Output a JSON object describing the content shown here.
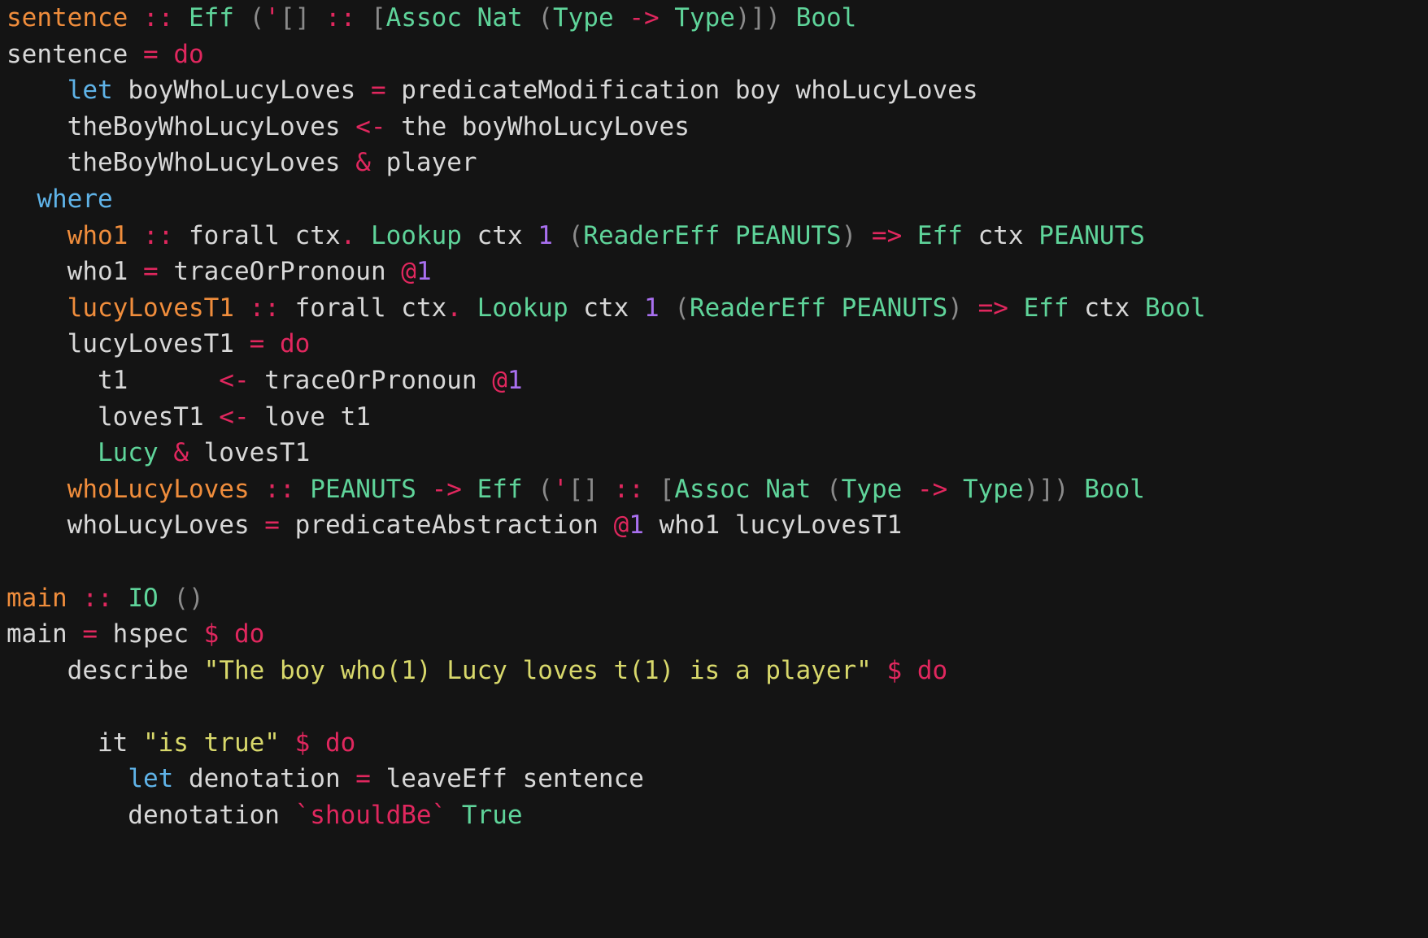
{
  "editor": {
    "language": "haskell",
    "background": "#141414",
    "font_size_px": 31,
    "line_height_px": 44.6
  },
  "colors": {
    "plain": "#d8d8d8",
    "function_name": "#f08d3c",
    "keyword": "#e0275e",
    "keyword_blue": "#5fb3e8",
    "type": "#5fd49a",
    "number": "#a970f0",
    "punctuation": "#8a8a8a",
    "string": "#d8d86b",
    "operator": "#e0275e"
  },
  "code": {
    "lines": [
      {
        "id": "line-1",
        "tokens": [
          {
            "text": "sentence",
            "style": "t-func"
          },
          {
            "text": " ",
            "style": "t-plain"
          },
          {
            "text": "::",
            "style": "t-kw"
          },
          {
            "text": " ",
            "style": "t-plain"
          },
          {
            "text": "Eff",
            "style": "t-type"
          },
          {
            "text": " ",
            "style": "t-plain"
          },
          {
            "text": "(",
            "style": "t-punct"
          },
          {
            "text": "'",
            "style": "t-kw"
          },
          {
            "text": "[]",
            "style": "t-punct"
          },
          {
            "text": " ",
            "style": "t-plain"
          },
          {
            "text": "::",
            "style": "t-kw"
          },
          {
            "text": " ",
            "style": "t-plain"
          },
          {
            "text": "[",
            "style": "t-punct"
          },
          {
            "text": "Assoc Nat ",
            "style": "t-type"
          },
          {
            "text": "(",
            "style": "t-punct"
          },
          {
            "text": "Type ",
            "style": "t-type"
          },
          {
            "text": "->",
            "style": "t-op"
          },
          {
            "text": " Type",
            "style": "t-type"
          },
          {
            "text": ")]) ",
            "style": "t-punct"
          },
          {
            "text": "Bool",
            "style": "t-type"
          }
        ]
      },
      {
        "id": "line-2",
        "tokens": [
          {
            "text": "sentence ",
            "style": "t-plain"
          },
          {
            "text": "=",
            "style": "t-kw"
          },
          {
            "text": " ",
            "style": "t-plain"
          },
          {
            "text": "do",
            "style": "t-kw"
          }
        ]
      },
      {
        "id": "line-3",
        "tokens": [
          {
            "text": "    ",
            "style": "t-plain"
          },
          {
            "text": "let",
            "style": "t-kwblue"
          },
          {
            "text": " boyWhoLucyLoves ",
            "style": "t-plain"
          },
          {
            "text": "=",
            "style": "t-kw"
          },
          {
            "text": " predicateModification boy whoLucyLoves",
            "style": "t-plain"
          }
        ]
      },
      {
        "id": "line-4",
        "tokens": [
          {
            "text": "    theBoyWhoLucyLoves ",
            "style": "t-plain"
          },
          {
            "text": "<-",
            "style": "t-kw"
          },
          {
            "text": " the boyWhoLucyLoves",
            "style": "t-plain"
          }
        ]
      },
      {
        "id": "line-5",
        "tokens": [
          {
            "text": "    theBoyWhoLucyLoves ",
            "style": "t-plain"
          },
          {
            "text": "&",
            "style": "t-kw"
          },
          {
            "text": " player",
            "style": "t-plain"
          }
        ]
      },
      {
        "id": "line-6",
        "tokens": [
          {
            "text": "  ",
            "style": "t-plain"
          },
          {
            "text": "where",
            "style": "t-kwblue"
          }
        ]
      },
      {
        "id": "line-7",
        "tokens": [
          {
            "text": "    ",
            "style": "t-plain"
          },
          {
            "text": "who1",
            "style": "t-func"
          },
          {
            "text": " ",
            "style": "t-plain"
          },
          {
            "text": "::",
            "style": "t-kw"
          },
          {
            "text": " forall ctx",
            "style": "t-plain"
          },
          {
            "text": ".",
            "style": "t-kw"
          },
          {
            "text": " ",
            "style": "t-plain"
          },
          {
            "text": "Lookup",
            "style": "t-type"
          },
          {
            "text": " ctx ",
            "style": "t-plain"
          },
          {
            "text": "1",
            "style": "t-num"
          },
          {
            "text": " ",
            "style": "t-plain"
          },
          {
            "text": "(",
            "style": "t-punct"
          },
          {
            "text": "ReaderEff PEANUTS",
            "style": "t-type"
          },
          {
            "text": ")",
            "style": "t-punct"
          },
          {
            "text": " ",
            "style": "t-plain"
          },
          {
            "text": "=>",
            "style": "t-op"
          },
          {
            "text": " ",
            "style": "t-plain"
          },
          {
            "text": "Eff",
            "style": "t-type"
          },
          {
            "text": " ctx ",
            "style": "t-plain"
          },
          {
            "text": "PEANUTS",
            "style": "t-type"
          }
        ]
      },
      {
        "id": "line-8",
        "tokens": [
          {
            "text": "    who1 ",
            "style": "t-plain"
          },
          {
            "text": "=",
            "style": "t-kw"
          },
          {
            "text": " traceOrPronoun ",
            "style": "t-plain"
          },
          {
            "text": "@",
            "style": "t-kw"
          },
          {
            "text": "1",
            "style": "t-num"
          }
        ]
      },
      {
        "id": "line-9",
        "tokens": [
          {
            "text": "    ",
            "style": "t-plain"
          },
          {
            "text": "lucyLovesT1",
            "style": "t-func"
          },
          {
            "text": " ",
            "style": "t-plain"
          },
          {
            "text": "::",
            "style": "t-kw"
          },
          {
            "text": " forall ctx",
            "style": "t-plain"
          },
          {
            "text": ".",
            "style": "t-kw"
          },
          {
            "text": " ",
            "style": "t-plain"
          },
          {
            "text": "Lookup",
            "style": "t-type"
          },
          {
            "text": " ctx ",
            "style": "t-plain"
          },
          {
            "text": "1",
            "style": "t-num"
          },
          {
            "text": " ",
            "style": "t-plain"
          },
          {
            "text": "(",
            "style": "t-punct"
          },
          {
            "text": "ReaderEff PEANUTS",
            "style": "t-type"
          },
          {
            "text": ")",
            "style": "t-punct"
          },
          {
            "text": " ",
            "style": "t-plain"
          },
          {
            "text": "=>",
            "style": "t-op"
          },
          {
            "text": " ",
            "style": "t-plain"
          },
          {
            "text": "Eff",
            "style": "t-type"
          },
          {
            "text": " ctx ",
            "style": "t-plain"
          },
          {
            "text": "Bool",
            "style": "t-type"
          }
        ]
      },
      {
        "id": "line-10",
        "tokens": [
          {
            "text": "    lucyLovesT1 ",
            "style": "t-plain"
          },
          {
            "text": "=",
            "style": "t-kw"
          },
          {
            "text": " ",
            "style": "t-plain"
          },
          {
            "text": "do",
            "style": "t-kw"
          }
        ]
      },
      {
        "id": "line-11",
        "tokens": [
          {
            "text": "      t1      ",
            "style": "t-plain"
          },
          {
            "text": "<-",
            "style": "t-kw"
          },
          {
            "text": " traceOrPronoun ",
            "style": "t-plain"
          },
          {
            "text": "@",
            "style": "t-kw"
          },
          {
            "text": "1",
            "style": "t-num"
          }
        ]
      },
      {
        "id": "line-12",
        "tokens": [
          {
            "text": "      lovesT1 ",
            "style": "t-plain"
          },
          {
            "text": "<-",
            "style": "t-kw"
          },
          {
            "text": " love t1",
            "style": "t-plain"
          }
        ]
      },
      {
        "id": "line-13",
        "tokens": [
          {
            "text": "      ",
            "style": "t-plain"
          },
          {
            "text": "Lucy",
            "style": "t-type"
          },
          {
            "text": " ",
            "style": "t-plain"
          },
          {
            "text": "&",
            "style": "t-kw"
          },
          {
            "text": " lovesT1",
            "style": "t-plain"
          }
        ]
      },
      {
        "id": "line-14",
        "tokens": [
          {
            "text": "    ",
            "style": "t-plain"
          },
          {
            "text": "whoLucyLoves",
            "style": "t-func"
          },
          {
            "text": " ",
            "style": "t-plain"
          },
          {
            "text": "::",
            "style": "t-kw"
          },
          {
            "text": " ",
            "style": "t-plain"
          },
          {
            "text": "PEANUTS",
            "style": "t-type"
          },
          {
            "text": " ",
            "style": "t-plain"
          },
          {
            "text": "->",
            "style": "t-op"
          },
          {
            "text": " ",
            "style": "t-plain"
          },
          {
            "text": "Eff",
            "style": "t-type"
          },
          {
            "text": " ",
            "style": "t-plain"
          },
          {
            "text": "(",
            "style": "t-punct"
          },
          {
            "text": "'",
            "style": "t-kw"
          },
          {
            "text": "[]",
            "style": "t-punct"
          },
          {
            "text": " ",
            "style": "t-plain"
          },
          {
            "text": "::",
            "style": "t-kw"
          },
          {
            "text": " ",
            "style": "t-plain"
          },
          {
            "text": "[",
            "style": "t-punct"
          },
          {
            "text": "Assoc Nat ",
            "style": "t-type"
          },
          {
            "text": "(",
            "style": "t-punct"
          },
          {
            "text": "Type ",
            "style": "t-type"
          },
          {
            "text": "->",
            "style": "t-op"
          },
          {
            "text": " Type",
            "style": "t-type"
          },
          {
            "text": ")]) ",
            "style": "t-punct"
          },
          {
            "text": "Bool",
            "style": "t-type"
          }
        ]
      },
      {
        "id": "line-15",
        "tokens": [
          {
            "text": "    whoLucyLoves ",
            "style": "t-plain"
          },
          {
            "text": "=",
            "style": "t-kw"
          },
          {
            "text": " predicateAbstraction ",
            "style": "t-plain"
          },
          {
            "text": "@",
            "style": "t-kw"
          },
          {
            "text": "1",
            "style": "t-num"
          },
          {
            "text": " who1 lucyLovesT1",
            "style": "t-plain"
          }
        ]
      },
      {
        "id": "line-16",
        "tokens": []
      },
      {
        "id": "line-17",
        "tokens": [
          {
            "text": "main",
            "style": "t-func"
          },
          {
            "text": " ",
            "style": "t-plain"
          },
          {
            "text": "::",
            "style": "t-kw"
          },
          {
            "text": " ",
            "style": "t-plain"
          },
          {
            "text": "IO",
            "style": "t-type"
          },
          {
            "text": " ",
            "style": "t-plain"
          },
          {
            "text": "()",
            "style": "t-punct"
          }
        ]
      },
      {
        "id": "line-18",
        "tokens": [
          {
            "text": "main ",
            "style": "t-plain"
          },
          {
            "text": "=",
            "style": "t-kw"
          },
          {
            "text": " hspec ",
            "style": "t-plain"
          },
          {
            "text": "$",
            "style": "t-kw"
          },
          {
            "text": " ",
            "style": "t-plain"
          },
          {
            "text": "do",
            "style": "t-kw"
          }
        ]
      },
      {
        "id": "line-19",
        "tokens": [
          {
            "text": "    describe ",
            "style": "t-plain"
          },
          {
            "text": "\"The boy who(1) Lucy loves t(1) is a player\"",
            "style": "t-str"
          },
          {
            "text": " ",
            "style": "t-plain"
          },
          {
            "text": "$",
            "style": "t-kw"
          },
          {
            "text": " ",
            "style": "t-plain"
          },
          {
            "text": "do",
            "style": "t-kw"
          }
        ]
      },
      {
        "id": "line-20",
        "tokens": []
      },
      {
        "id": "line-21",
        "tokens": [
          {
            "text": "      it ",
            "style": "t-plain"
          },
          {
            "text": "\"is true\"",
            "style": "t-str"
          },
          {
            "text": " ",
            "style": "t-plain"
          },
          {
            "text": "$",
            "style": "t-kw"
          },
          {
            "text": " ",
            "style": "t-plain"
          },
          {
            "text": "do",
            "style": "t-kw"
          }
        ]
      },
      {
        "id": "line-22",
        "tokens": [
          {
            "text": "        ",
            "style": "t-plain"
          },
          {
            "text": "let",
            "style": "t-kwblue"
          },
          {
            "text": " denotation ",
            "style": "t-plain"
          },
          {
            "text": "=",
            "style": "t-kw"
          },
          {
            "text": " leaveEff sentence",
            "style": "t-plain"
          }
        ]
      },
      {
        "id": "line-23",
        "tokens": [
          {
            "text": "        denotation ",
            "style": "t-plain"
          },
          {
            "text": "`shouldBe`",
            "style": "t-kw"
          },
          {
            "text": " ",
            "style": "t-plain"
          },
          {
            "text": "True",
            "style": "t-type"
          }
        ]
      }
    ]
  }
}
